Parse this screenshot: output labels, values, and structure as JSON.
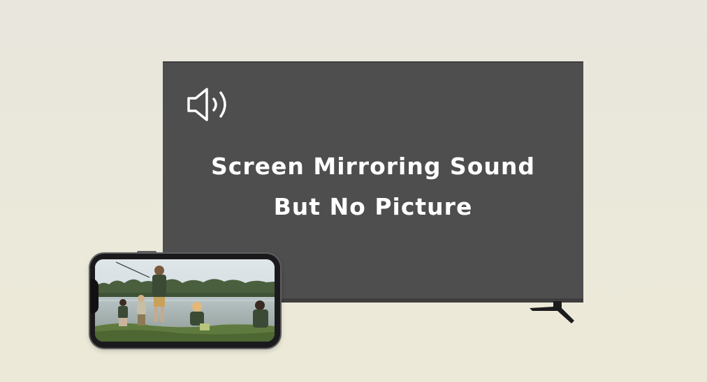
{
  "headline": {
    "line1": "Screen Mirroring Sound",
    "line2": "But No Picture"
  },
  "icons": {
    "tv_icon": "speaker-volume-icon"
  },
  "colors": {
    "background": "#ebe9da",
    "tv_screen": "#4f4e4f",
    "text": "#ffffff"
  }
}
